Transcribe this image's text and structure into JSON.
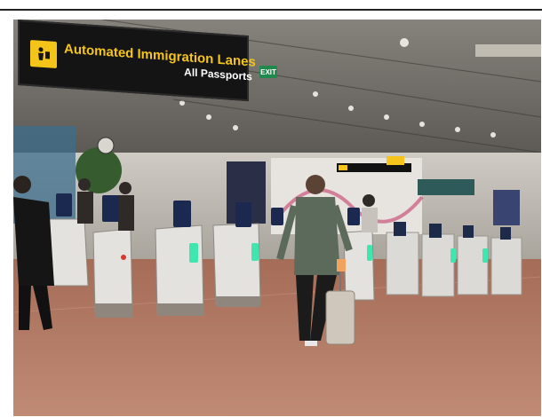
{
  "sign": {
    "title": "Automated Immigration Lanes",
    "subtitle": "All Passports",
    "icon": "person-passport-icon"
  },
  "exit_sign": {
    "label": "EXIT"
  },
  "colors": {
    "sign_background": "#141414",
    "sign_title": "#f6c51b",
    "sign_subtitle": "#ffffff",
    "floor": "#b47a62",
    "gate_body": "#e4e2de",
    "gate_indicator": "#3fe6b0",
    "ceiling": "#6e6b66"
  }
}
